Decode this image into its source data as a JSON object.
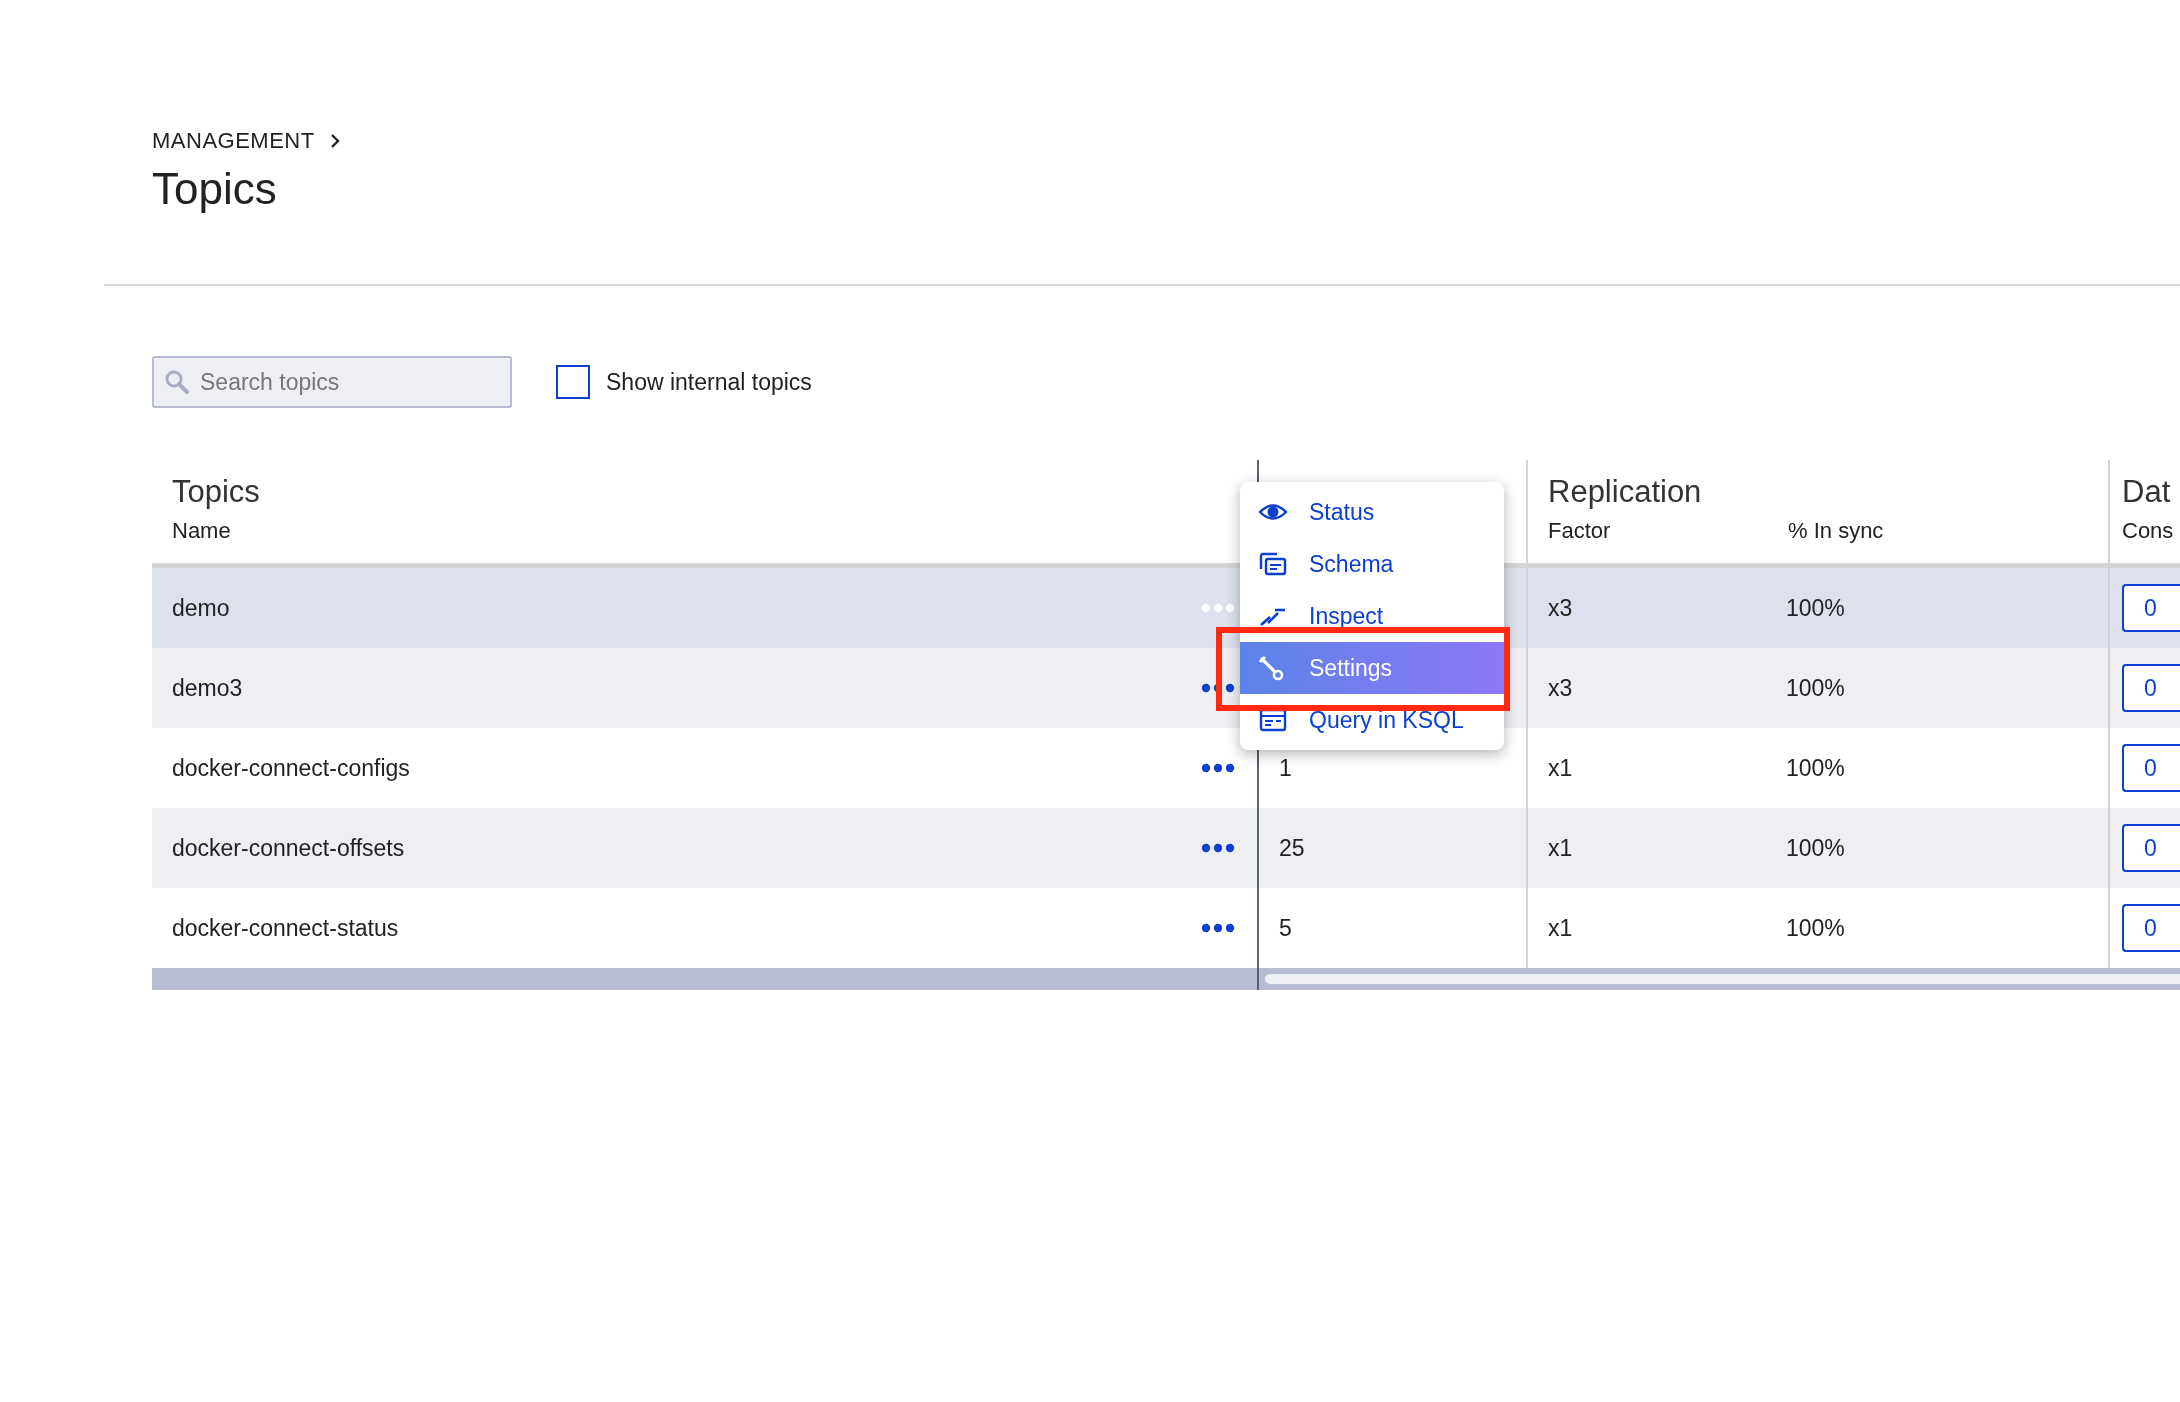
{
  "breadcrumb": {
    "label": "MANAGEMENT"
  },
  "title": "Topics",
  "search": {
    "placeholder": "Search topics"
  },
  "show_internal": {
    "label": "Show internal topics",
    "checked": false
  },
  "table": {
    "groups": [
      "Topics",
      "Replication",
      "Dat"
    ],
    "columns": [
      "Name",
      "Factor",
      "% In sync",
      "Cons"
    ],
    "rows": [
      {
        "name": "demo",
        "selected": true,
        "factor": "x3",
        "in_sync": "100%",
        "consumers": "0"
      },
      {
        "name": "demo3",
        "selected": false,
        "factor": "x3",
        "in_sync": "100%",
        "consumers": "0"
      },
      {
        "name": "docker-connect-configs",
        "selected": false,
        "partitions": "1",
        "factor": "x1",
        "in_sync": "100%",
        "consumers": "0"
      },
      {
        "name": "docker-connect-offsets",
        "selected": false,
        "partitions": "25",
        "factor": "x1",
        "in_sync": "100%",
        "consumers": "0"
      },
      {
        "name": "docker-connect-status",
        "selected": false,
        "partitions": "5",
        "factor": "x1",
        "in_sync": "100%",
        "consumers": "0"
      }
    ]
  },
  "context_menu": {
    "items": [
      {
        "label": "Status",
        "selected": false
      },
      {
        "label": "Schema",
        "selected": false
      },
      {
        "label": "Inspect",
        "selected": false
      },
      {
        "label": "Settings",
        "selected": true
      },
      {
        "label": "Query in KSQL",
        "selected": false
      }
    ]
  }
}
